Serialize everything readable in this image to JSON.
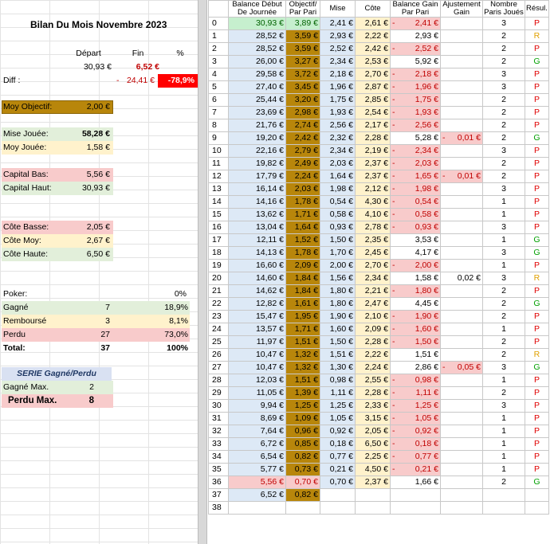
{
  "left": {
    "title": "Bilan Du Mois Novembre 2023",
    "hdr_depart": "Départ",
    "hdr_fin": "Fin",
    "hdr_pct": "%",
    "depart_val": "30,93 €",
    "fin_val": "6,52 €",
    "diff_label": "Diff :",
    "diff_sign": "-",
    "diff_val": "24,41 €",
    "diff_pct": "-78,9%",
    "moy_obj_label": "Moy Objectif:",
    "moy_obj_val": "2,00 €",
    "mise_label": "Mise Jouée:",
    "mise_val": "58,28 €",
    "moy_jouee_label": "Moy Jouée:",
    "moy_jouee_val": "1,58 €",
    "cap_bas_label": "Capital Bas:",
    "cap_bas_val": "5,56 €",
    "cap_haut_label": "Capital Haut:",
    "cap_haut_val": "30,93 €",
    "cote_basse_label": "Côte Basse:",
    "cote_basse_val": "2,05 €",
    "cote_moy_label": "Côte Moy:",
    "cote_moy_val": "2,67 €",
    "cote_haute_label": "Côte Haute:",
    "cote_haute_val": "6,50 €",
    "poker_label": "Poker:",
    "poker_pct": "0%",
    "gagne_label": "Gagné",
    "gagne_n": "7",
    "gagne_pct": "18,9%",
    "rembourse_label": "Remboursé",
    "rembourse_n": "3",
    "rembourse_pct": "8,1%",
    "perdu_label": "Perdu",
    "perdu_n": "27",
    "perdu_pct": "73,0%",
    "total_label": "Total:",
    "total_n": "37",
    "total_pct": "100%",
    "serie_label": "SERIE Gagné/Perdu",
    "gagne_max_label": "Gagné Max.",
    "gagne_max_val": "2",
    "perdu_max_label": "Perdu Max.",
    "perdu_max_val": "8"
  },
  "table": {
    "headers": [
      [
        "",
        ""
      ],
      [
        "Balance Début",
        "De Journée"
      ],
      [
        "Objectif/",
        "Par Pari"
      ],
      [
        "Mise",
        ""
      ],
      [
        "Côte",
        ""
      ],
      [
        "Balance Gain",
        "Par Pari"
      ],
      [
        "Ajustement",
        "Gain"
      ],
      [
        "Nombre",
        "Paris Joués"
      ],
      [
        "Résul.",
        ""
      ]
    ],
    "rows": [
      [
        "0",
        "30,93 €",
        "3,89 €",
        "2,41 €",
        "2,61 €",
        "-",
        "2,41 €",
        "",
        "",
        "3",
        "P"
      ],
      [
        "1",
        "28,52 €",
        "3,59 €",
        "2,93 €",
        "2,22 €",
        "",
        "2,93 €",
        "",
        "",
        "2",
        "R"
      ],
      [
        "2",
        "28,52 €",
        "3,59 €",
        "2,52 €",
        "2,42 €",
        "-",
        "2,52 €",
        "",
        "",
        "2",
        "P"
      ],
      [
        "3",
        "26,00 €",
        "3,27 €",
        "2,34 €",
        "2,53 €",
        "",
        "5,92 €",
        "",
        "",
        "2",
        "G"
      ],
      [
        "4",
        "29,58 €",
        "3,72 €",
        "2,18 €",
        "2,70 €",
        "-",
        "2,18 €",
        "",
        "",
        "3",
        "P"
      ],
      [
        "5",
        "27,40 €",
        "3,45 €",
        "1,96 €",
        "2,87 €",
        "-",
        "1,96 €",
        "",
        "",
        "3",
        "P"
      ],
      [
        "6",
        "25,44 €",
        "3,20 €",
        "1,75 €",
        "2,85 €",
        "-",
        "1,75 €",
        "",
        "",
        "2",
        "P"
      ],
      [
        "7",
        "23,69 €",
        "2,98 €",
        "1,93 €",
        "2,54 €",
        "-",
        "1,93 €",
        "",
        "",
        "2",
        "P"
      ],
      [
        "8",
        "21,76 €",
        "2,74 €",
        "2,56 €",
        "2,17 €",
        "-",
        "2,56 €",
        "",
        "",
        "2",
        "P"
      ],
      [
        "9",
        "19,20 €",
        "2,42 €",
        "2,32 €",
        "2,28 €",
        "",
        "5,28 €",
        "-",
        "0,01 €",
        "2",
        "G"
      ],
      [
        "10",
        "22,16 €",
        "2,79 €",
        "2,34 €",
        "2,19 €",
        "-",
        "2,34 €",
        "",
        "",
        "3",
        "P"
      ],
      [
        "11",
        "19,82 €",
        "2,49 €",
        "2,03 €",
        "2,37 €",
        "-",
        "2,03 €",
        "",
        "",
        "2",
        "P"
      ],
      [
        "12",
        "17,79 €",
        "2,24 €",
        "1,64 €",
        "2,37 €",
        "-",
        "1,65 €",
        "-",
        "0,01 €",
        "2",
        "P"
      ],
      [
        "13",
        "16,14 €",
        "2,03 €",
        "1,98 €",
        "2,12 €",
        "-",
        "1,98 €",
        "",
        "",
        "3",
        "P"
      ],
      [
        "14",
        "14,16 €",
        "1,78 €",
        "0,54 €",
        "4,30 €",
        "-",
        "0,54 €",
        "",
        "",
        "1",
        "P"
      ],
      [
        "15",
        "13,62 €",
        "1,71 €",
        "0,58 €",
        "4,10 €",
        "-",
        "0,58 €",
        "",
        "",
        "1",
        "P"
      ],
      [
        "16",
        "13,04 €",
        "1,64 €",
        "0,93 €",
        "2,78 €",
        "-",
        "0,93 €",
        "",
        "",
        "3",
        "P"
      ],
      [
        "17",
        "12,11 €",
        "1,52 €",
        "1,50 €",
        "2,35 €",
        "",
        "3,53 €",
        "",
        "",
        "1",
        "G"
      ],
      [
        "18",
        "14,13 €",
        "1,78 €",
        "1,70 €",
        "2,45 €",
        "",
        "4,17 €",
        "",
        "",
        "3",
        "G"
      ],
      [
        "19",
        "16,60 €",
        "2,09 €",
        "2,00 €",
        "2,70 €",
        "-",
        "2,00 €",
        "",
        "",
        "1",
        "P"
      ],
      [
        "20",
        "14,60 €",
        "1,84 €",
        "1,56 €",
        "2,34 €",
        "",
        "1,58 €",
        "",
        "0,02 €",
        "3",
        "R"
      ],
      [
        "21",
        "14,62 €",
        "1,84 €",
        "1,80 €",
        "2,21 €",
        "-",
        "1,80 €",
        "",
        "",
        "2",
        "P"
      ],
      [
        "22",
        "12,82 €",
        "1,61 €",
        "1,80 €",
        "2,47 €",
        "",
        "4,45 €",
        "",
        "",
        "2",
        "G"
      ],
      [
        "23",
        "15,47 €",
        "1,95 €",
        "1,90 €",
        "2,10 €",
        "-",
        "1,90 €",
        "",
        "",
        "2",
        "P"
      ],
      [
        "24",
        "13,57 €",
        "1,71 €",
        "1,60 €",
        "2,09 €",
        "-",
        "1,60 €",
        "",
        "",
        "1",
        "P"
      ],
      [
        "25",
        "11,97 €",
        "1,51 €",
        "1,50 €",
        "2,28 €",
        "-",
        "1,50 €",
        "",
        "",
        "2",
        "P"
      ],
      [
        "26",
        "10,47 €",
        "1,32 €",
        "1,51 €",
        "2,22 €",
        "",
        "1,51 €",
        "",
        "",
        "2",
        "R"
      ],
      [
        "27",
        "10,47 €",
        "1,32 €",
        "1,30 €",
        "2,24 €",
        "",
        "2,86 €",
        "-",
        "0,05 €",
        "3",
        "G"
      ],
      [
        "28",
        "12,03 €",
        "1,51 €",
        "0,98 €",
        "2,55 €",
        "-",
        "0,98 €",
        "",
        "",
        "1",
        "P"
      ],
      [
        "29",
        "11,05 €",
        "1,39 €",
        "1,11 €",
        "2,28 €",
        "-",
        "1,11 €",
        "",
        "",
        "2",
        "P"
      ],
      [
        "30",
        "9,94 €",
        "1,25 €",
        "1,25 €",
        "2,33 €",
        "-",
        "1,25 €",
        "",
        "",
        "3",
        "P"
      ],
      [
        "31",
        "8,69 €",
        "1,09 €",
        "1,05 €",
        "3,15 €",
        "-",
        "1,05 €",
        "",
        "",
        "1",
        "P"
      ],
      [
        "32",
        "7,64 €",
        "0,96 €",
        "0,92 €",
        "2,05 €",
        "-",
        "0,92 €",
        "",
        "",
        "1",
        "P"
      ],
      [
        "33",
        "6,72 €",
        "0,85 €",
        "0,18 €",
        "6,50 €",
        "-",
        "0,18 €",
        "",
        "",
        "1",
        "P"
      ],
      [
        "34",
        "6,54 €",
        "0,82 €",
        "0,77 €",
        "2,25 €",
        "-",
        "0,77 €",
        "",
        "",
        "1",
        "P"
      ],
      [
        "35",
        "5,77 €",
        "0,73 €",
        "0,21 €",
        "4,50 €",
        "-",
        "0,21 €",
        "",
        "",
        "1",
        "P"
      ],
      [
        "36",
        "5,56 €",
        "0,70 €",
        "0,70 €",
        "2,37 €",
        "",
        "1,66 €",
        "",
        "",
        "2",
        "G"
      ],
      [
        "37",
        "6,52 €",
        "0,82 €",
        "",
        "",
        "",
        "",
        "",
        "",
        "",
        ""
      ],
      [
        "38",
        "",
        "",
        "",
        "",
        "",
        "",
        "",
        "",
        "",
        ""
      ]
    ]
  },
  "colors": {
    "blue": "#dde9f6",
    "gold": "#b8860b",
    "yellow": "#fff2cc",
    "pink": "#f8cbcb",
    "green": "#e2efda",
    "greenHi": "#c6efce",
    "redBright": "#ff0000",
    "resP": "#e00000",
    "resG": "#00a000",
    "resR": "#e0a000"
  }
}
